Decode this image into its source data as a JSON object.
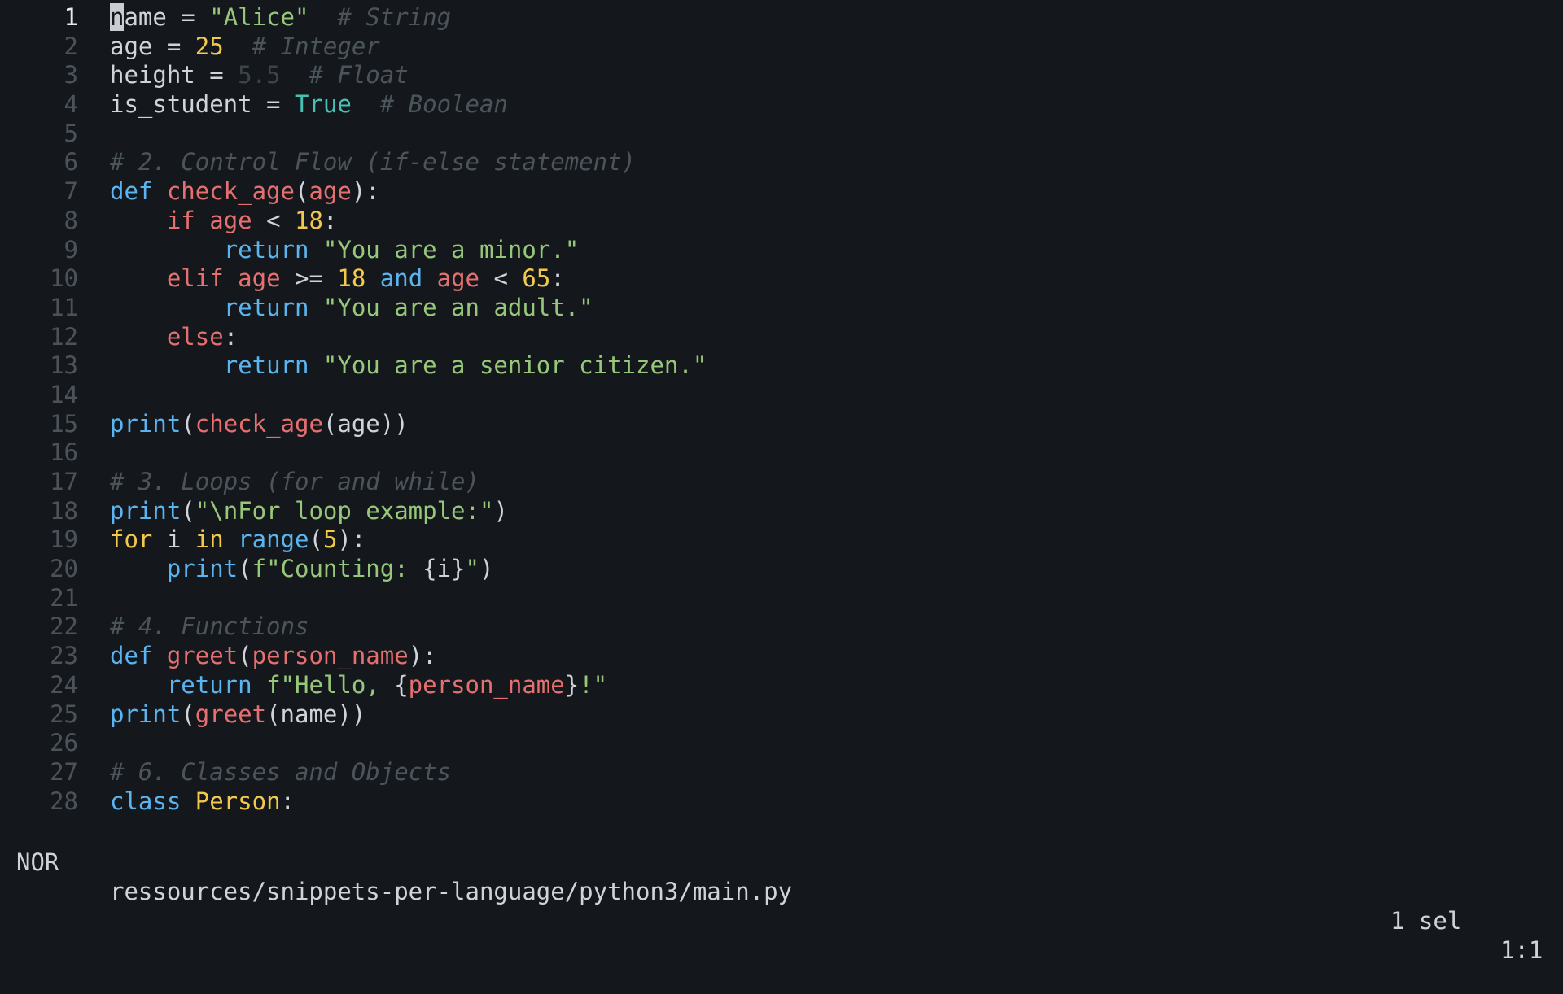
{
  "editor": {
    "lines": [
      {
        "n": "1",
        "tokens": [
          {
            "t": "n",
            "c": "cursor"
          },
          {
            "t": "ame = ",
            "c": "pl"
          },
          {
            "t": "\"Alice\"",
            "c": "str"
          },
          {
            "t": "  # String",
            "c": "cm"
          }
        ]
      },
      {
        "n": "2",
        "tokens": [
          {
            "t": "age = ",
            "c": "pl"
          },
          {
            "t": "25",
            "c": "num"
          },
          {
            "t": "  # Integer",
            "c": "cm"
          }
        ]
      },
      {
        "n": "3",
        "tokens": [
          {
            "t": "height = ",
            "c": "pl"
          },
          {
            "t": "5.5",
            "c": "dim"
          },
          {
            "t": "  # Float",
            "c": "cm"
          }
        ]
      },
      {
        "n": "4",
        "tokens": [
          {
            "t": "is_student = ",
            "c": "pl"
          },
          {
            "t": "True",
            "c": "con"
          },
          {
            "t": "  # Boolean",
            "c": "cm"
          }
        ]
      },
      {
        "n": "5",
        "tokens": []
      },
      {
        "n": "6",
        "tokens": [
          {
            "t": "# 2. Control Flow (if-else statement)",
            "c": "cm"
          }
        ]
      },
      {
        "n": "7",
        "tokens": [
          {
            "t": "def ",
            "c": "kw"
          },
          {
            "t": "check_age",
            "c": "fn"
          },
          {
            "t": "(",
            "c": "pl"
          },
          {
            "t": "age",
            "c": "var"
          },
          {
            "t": "):",
            "c": "pl"
          }
        ]
      },
      {
        "n": "8",
        "tokens": [
          {
            "t": "    ",
            "c": "pl"
          },
          {
            "t": "if ",
            "c": "kw2"
          },
          {
            "t": "age",
            "c": "var"
          },
          {
            "t": " < ",
            "c": "pl"
          },
          {
            "t": "18",
            "c": "num"
          },
          {
            "t": ":",
            "c": "pl"
          }
        ]
      },
      {
        "n": "9",
        "tokens": [
          {
            "t": "        ",
            "c": "pl"
          },
          {
            "t": "return ",
            "c": "kw"
          },
          {
            "t": "\"You are a minor.\"",
            "c": "str"
          }
        ]
      },
      {
        "n": "10",
        "tokens": [
          {
            "t": "    ",
            "c": "pl"
          },
          {
            "t": "elif ",
            "c": "kw2"
          },
          {
            "t": "age",
            "c": "var"
          },
          {
            "t": " >= ",
            "c": "pl"
          },
          {
            "t": "18",
            "c": "num"
          },
          {
            "t": " and ",
            "c": "kw"
          },
          {
            "t": "age",
            "c": "var"
          },
          {
            "t": " < ",
            "c": "pl"
          },
          {
            "t": "65",
            "c": "num"
          },
          {
            "t": ":",
            "c": "pl"
          }
        ]
      },
      {
        "n": "11",
        "tokens": [
          {
            "t": "        ",
            "c": "pl"
          },
          {
            "t": "return ",
            "c": "kw"
          },
          {
            "t": "\"You are an adult.\"",
            "c": "str"
          }
        ]
      },
      {
        "n": "12",
        "tokens": [
          {
            "t": "    ",
            "c": "pl"
          },
          {
            "t": "else",
            "c": "kw2"
          },
          {
            "t": ":",
            "c": "pl"
          }
        ]
      },
      {
        "n": "13",
        "tokens": [
          {
            "t": "        ",
            "c": "pl"
          },
          {
            "t": "return ",
            "c": "kw"
          },
          {
            "t": "\"You are a senior citizen.\"",
            "c": "str"
          }
        ]
      },
      {
        "n": "14",
        "tokens": []
      },
      {
        "n": "15",
        "tokens": [
          {
            "t": "print",
            "c": "bi"
          },
          {
            "t": "(",
            "c": "pl"
          },
          {
            "t": "check_age",
            "c": "fn"
          },
          {
            "t": "(age))",
            "c": "pl"
          }
        ]
      },
      {
        "n": "16",
        "tokens": []
      },
      {
        "n": "17",
        "tokens": [
          {
            "t": "# 3. Loops (for and while)",
            "c": "cm"
          }
        ]
      },
      {
        "n": "18",
        "tokens": [
          {
            "t": "print",
            "c": "bi"
          },
          {
            "t": "(",
            "c": "pl"
          },
          {
            "t": "\"\\nFor loop example:\"",
            "c": "str"
          },
          {
            "t": ")",
            "c": "pl"
          }
        ]
      },
      {
        "n": "19",
        "tokens": [
          {
            "t": "for ",
            "c": "kwy"
          },
          {
            "t": "i ",
            "c": "pl"
          },
          {
            "t": "in ",
            "c": "kwy"
          },
          {
            "t": "range",
            "c": "bi"
          },
          {
            "t": "(",
            "c": "pl"
          },
          {
            "t": "5",
            "c": "num"
          },
          {
            "t": "):",
            "c": "pl"
          }
        ]
      },
      {
        "n": "20",
        "tokens": [
          {
            "t": "    ",
            "c": "pl"
          },
          {
            "t": "print",
            "c": "bi"
          },
          {
            "t": "(",
            "c": "pl"
          },
          {
            "t": "f\"Counting: ",
            "c": "str"
          },
          {
            "t": "{i}",
            "c": "pl"
          },
          {
            "t": "\"",
            "c": "str"
          },
          {
            "t": ")",
            "c": "pl"
          }
        ]
      },
      {
        "n": "21",
        "tokens": []
      },
      {
        "n": "22",
        "tokens": [
          {
            "t": "# 4. Functions",
            "c": "cm"
          }
        ]
      },
      {
        "n": "23",
        "tokens": [
          {
            "t": "def ",
            "c": "kw"
          },
          {
            "t": "greet",
            "c": "fn"
          },
          {
            "t": "(",
            "c": "pl"
          },
          {
            "t": "person_name",
            "c": "var"
          },
          {
            "t": "):",
            "c": "pl"
          }
        ]
      },
      {
        "n": "24",
        "tokens": [
          {
            "t": "    ",
            "c": "pl"
          },
          {
            "t": "return ",
            "c": "kw"
          },
          {
            "t": "f\"Hello, ",
            "c": "str"
          },
          {
            "t": "{",
            "c": "pl"
          },
          {
            "t": "person_name",
            "c": "var"
          },
          {
            "t": "}",
            "c": "pl"
          },
          {
            "t": "!\"",
            "c": "str"
          }
        ]
      },
      {
        "n": "25",
        "tokens": [
          {
            "t": "print",
            "c": "bi"
          },
          {
            "t": "(",
            "c": "pl"
          },
          {
            "t": "greet",
            "c": "fn"
          },
          {
            "t": "(name))",
            "c": "pl"
          }
        ]
      },
      {
        "n": "26",
        "tokens": []
      },
      {
        "n": "27",
        "tokens": [
          {
            "t": "# 6. Classes and Objects",
            "c": "cm"
          }
        ]
      },
      {
        "n": "28",
        "tokens": [
          {
            "t": "class ",
            "c": "kw"
          },
          {
            "t": "Person",
            "c": "cls"
          },
          {
            "t": ":",
            "c": "pl"
          }
        ]
      }
    ],
    "current_line": "1"
  },
  "statusbar": {
    "mode": "NOR",
    "file_path": "ressources/snippets-per-language/python3/main.py",
    "selection": "1 sel",
    "position": "1:1"
  }
}
